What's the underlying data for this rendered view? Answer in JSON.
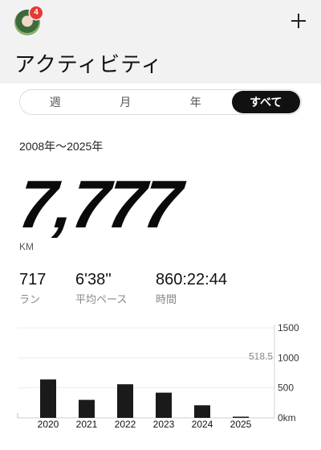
{
  "header": {
    "badge_count": "4",
    "title": "アクティビティ",
    "add_icon": "plus-icon"
  },
  "tabs": [
    {
      "label": "週"
    },
    {
      "label": "月"
    },
    {
      "label": "年"
    },
    {
      "label": "すべて",
      "selected": true
    }
  ],
  "summary": {
    "date_range": "2008年〜2025年",
    "total_distance": "7,777",
    "unit": "KM",
    "stats": [
      {
        "value": "717",
        "label": "ラン"
      },
      {
        "value": "6'38''",
        "label": "平均ペース"
      },
      {
        "value": "860:22:44",
        "label": "時間"
      }
    ]
  },
  "colors": {
    "accent": "#111111",
    "badge": "#e53935",
    "header_bg": "#f2f2f2"
  },
  "chart_data": {
    "type": "bar",
    "categories": [
      "2020",
      "2021",
      "2022",
      "2023",
      "2024",
      "2025"
    ],
    "values": [
      640,
      300,
      560,
      420,
      210,
      20
    ],
    "ylim": [
      0,
      1500
    ],
    "yticks": [
      "0km",
      "500",
      "1000",
      "1500"
    ],
    "reference_label": "518.5",
    "reference_value": 518.5,
    "bar_color": "#1a1a1a",
    "grid": true
  }
}
